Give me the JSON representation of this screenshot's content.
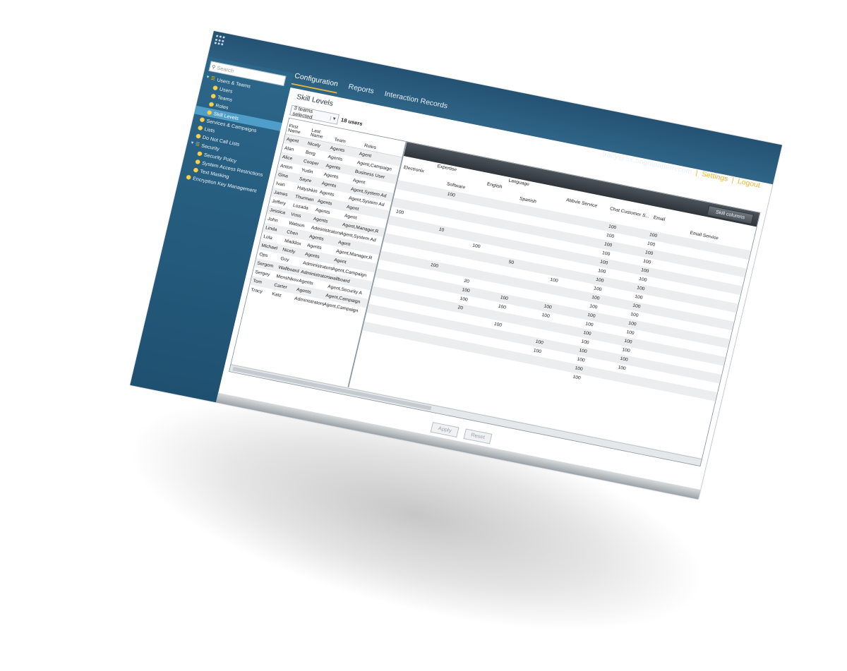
{
  "header": {
    "tabs": [
      {
        "label": "Configuration"
      },
      {
        "label": "Reports"
      },
      {
        "label": "Interaction Records"
      }
    ],
    "user": "tracy@5x.brightpattern.com",
    "settings_label": "Settings",
    "logout_label": "Logout",
    "separator": "|"
  },
  "sidebar": {
    "search_placeholder": "Search",
    "items": [
      {
        "label": "Users & Teams"
      },
      {
        "label": "Users"
      },
      {
        "label": "Teams"
      },
      {
        "label": "Roles"
      },
      {
        "label": "Skill Levels"
      },
      {
        "label": "Services & Campaigns"
      },
      {
        "label": "Lists"
      },
      {
        "label": "Do Not Call Lists"
      },
      {
        "label": "Security"
      },
      {
        "label": "Security Policy"
      },
      {
        "label": "System Access Restrictions"
      },
      {
        "label": "Text Masking"
      },
      {
        "label": "Encryption Key Management"
      }
    ]
  },
  "content": {
    "title": "Skill Levels",
    "team_select": "3 teams selected",
    "user_count": "18 users",
    "skill_columns_button": "Skill columns",
    "apply_label": "Apply",
    "reset_label": "Reset",
    "left_headers": [
      "First Name",
      "Last Name",
      "Team",
      "Roles"
    ],
    "right_headers": {
      "expertise": "Expertise",
      "electronix": "Electronix",
      "software": "Software",
      "language": "Language",
      "english": "English",
      "spanish": "Spanish",
      "abbvie": "Abbvie Service",
      "chat": "Chat Customer S...",
      "email": "Email",
      "email_service": "Email Service"
    },
    "agents": [
      {
        "first": "Agent",
        "last": "Nicely",
        "team": "Agents",
        "roles": "Agent"
      },
      {
        "first": "Alan",
        "last": "Berg",
        "team": "Agents",
        "roles": "Agent,Campaign"
      },
      {
        "first": "Alice",
        "last": "Cooper",
        "team": "Agents",
        "roles": "Business User"
      },
      {
        "first": "Anton",
        "last": "Yudin",
        "team": "Agents",
        "roles": "Agent"
      },
      {
        "first": "Gina",
        "last": "Sayre",
        "team": "Agents",
        "roles": "Agent,System Ad"
      },
      {
        "first": "Ivan",
        "last": "Halyshkin",
        "team": "Agents",
        "roles": "Agent,System Ad"
      },
      {
        "first": "James",
        "last": "Thurman",
        "team": "Agents",
        "roles": "Agent"
      },
      {
        "first": "Jeffery",
        "last": "Lozada",
        "team": "Agents",
        "roles": "Agent"
      },
      {
        "first": "Jessica",
        "last": "Voss",
        "team": "Agents",
        "roles": "Agent,Manager,R"
      },
      {
        "first": "John",
        "last": "Watson",
        "team": "Administrators",
        "roles": "Agent,System Ad"
      },
      {
        "first": "Linda",
        "last": "Chen",
        "team": "Agents",
        "roles": "Agent"
      },
      {
        "first": "Lola",
        "last": "Maddox",
        "team": "Agents",
        "roles": "Agent,Manager,R"
      },
      {
        "first": "Michael",
        "last": "Nicely",
        "team": "Agents",
        "roles": "Agent"
      },
      {
        "first": "Ops",
        "last": "Guy",
        "team": "Administrators",
        "roles": "Agent,Campaign"
      },
      {
        "first": "Sergem",
        "last": "Wallboard",
        "team": "Administrators",
        "roles": "wallboard"
      },
      {
        "first": "Sergey",
        "last": "Menshikov",
        "team": "Agents",
        "roles": "Agent,Security A"
      },
      {
        "first": "Tom",
        "last": "Carter",
        "team": "Agents",
        "roles": "Agent,Campaign"
      },
      {
        "first": "Tracy",
        "last": "Katz",
        "team": "Administrators",
        "roles": "Agent,Campaign"
      }
    ],
    "skill_rows": [
      {
        "electronix": "",
        "software": "100",
        "english": "",
        "spanish": "",
        "abbvie": "",
        "chat": "100",
        "email": "100"
      },
      {
        "electronix": "",
        "software": "",
        "english": "",
        "spanish": "",
        "abbvie": "",
        "chat": "100",
        "email": "100"
      },
      {
        "electronix": "",
        "software": "",
        "english": "",
        "spanish": "",
        "abbvie": "",
        "chat": "100",
        "email": "100"
      },
      {
        "electronix": "100",
        "software": "",
        "english": "",
        "spanish": "",
        "abbvie": "",
        "chat": "100",
        "email": "100"
      },
      {
        "electronix": "",
        "software": "10",
        "english": "",
        "spanish": "",
        "abbvie": "",
        "chat": "100",
        "email": "100"
      },
      {
        "electronix": "",
        "software": "",
        "english": "100",
        "spanish": "",
        "abbvie": "",
        "chat": "100",
        "email": "100"
      },
      {
        "electronix": "",
        "software": "",
        "english": "",
        "spanish": "50",
        "abbvie": "",
        "chat": "100",
        "email": "100"
      },
      {
        "electronix": "",
        "software": "",
        "english": "",
        "spanish": "",
        "abbvie": "100",
        "chat": "100",
        "email": "100"
      },
      {
        "electronix": "",
        "software": "100",
        "english": "",
        "spanish": "",
        "abbvie": "",
        "chat": "100",
        "email": "100"
      },
      {
        "electronix": "",
        "software": "",
        "english": "20",
        "spanish": "",
        "abbvie": "",
        "chat": "100",
        "email": "100"
      },
      {
        "electronix": "",
        "software": "",
        "english": "100",
        "spanish": "100",
        "abbvie": "100",
        "chat": "100",
        "email": "100"
      },
      {
        "electronix": "",
        "software": "",
        "english": "100",
        "spanish": "100",
        "abbvie": "100",
        "chat": "100",
        "email": "100"
      },
      {
        "electronix": "",
        "software": "",
        "english": "20",
        "spanish": "",
        "abbvie": "",
        "chat": "100",
        "email": "100"
      },
      {
        "electronix": "",
        "software": "",
        "english": "",
        "spanish": "100",
        "abbvie": "",
        "chat": "100",
        "email": "100"
      },
      {
        "electronix": "",
        "software": "",
        "english": "",
        "spanish": "",
        "abbvie": "100",
        "chat": "100",
        "email": "100"
      },
      {
        "electronix": "",
        "software": "",
        "english": "",
        "spanish": "",
        "abbvie": "100",
        "chat": "100",
        "email": "100"
      },
      {
        "electronix": "",
        "software": "",
        "english": "",
        "spanish": "",
        "abbvie": "",
        "chat": "100",
        "email": ""
      },
      {
        "electronix": "",
        "software": "",
        "english": "",
        "spanish": "",
        "abbvie": "",
        "chat": "100",
        "email": ""
      }
    ]
  }
}
